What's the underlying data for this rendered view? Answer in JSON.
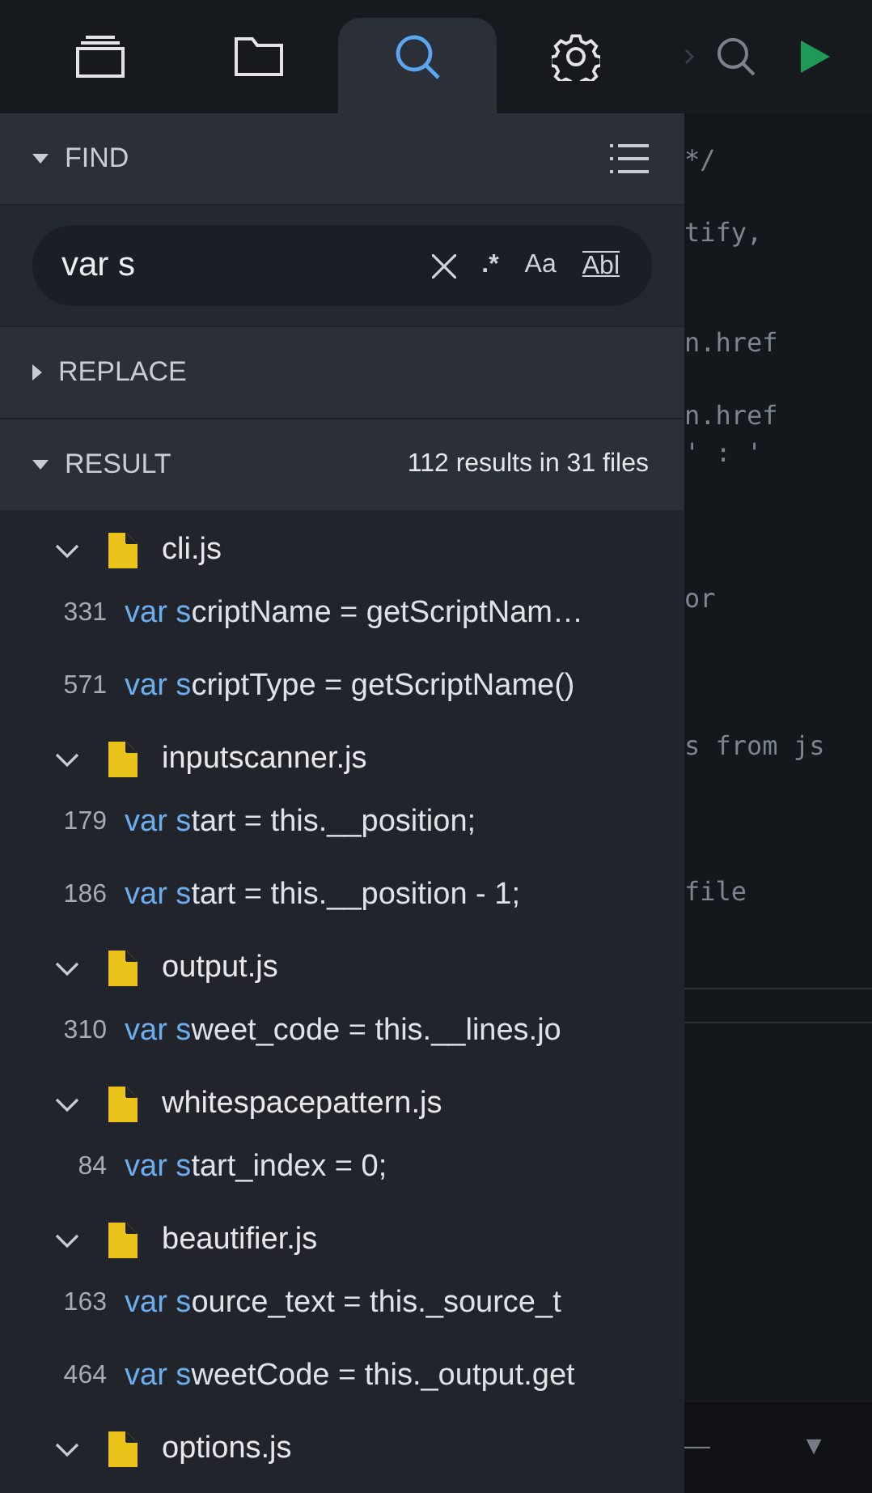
{
  "tabs": [
    {
      "kind": "windows",
      "selected": false
    },
    {
      "kind": "folder",
      "selected": false
    },
    {
      "kind": "search",
      "selected": true
    },
    {
      "kind": "settings",
      "selected": false
    }
  ],
  "find": {
    "title": "FIND",
    "expanded": true,
    "query": "var s",
    "regex_label": ".*",
    "case_label": "Aa",
    "word_label": "Abl"
  },
  "replace": {
    "title": "REPLACE",
    "expanded": false
  },
  "result": {
    "title": "RESULT",
    "expanded": true,
    "summary": "112 results in 31 files"
  },
  "files": [
    {
      "name": "cli.js",
      "expanded": true,
      "matches": [
        {
          "line": "331",
          "match": "var s",
          "rest": "criptName = getScriptNam…"
        },
        {
          "line": "571",
          "match": "var s",
          "rest": "criptType = getScriptName()"
        }
      ]
    },
    {
      "name": "inputscanner.js",
      "expanded": true,
      "matches": [
        {
          "line": "179",
          "match": "var s",
          "rest": "tart = this.__position;"
        },
        {
          "line": "186",
          "match": "var s",
          "rest": "tart = this.__position - 1;"
        }
      ]
    },
    {
      "name": "output.js",
      "expanded": true,
      "matches": [
        {
          "line": "310",
          "match": "var s",
          "rest": "weet_code = this.__lines.jo"
        }
      ]
    },
    {
      "name": "whitespacepattern.js",
      "expanded": true,
      "matches": [
        {
          "line": "84",
          "match": "var s",
          "rest": "tart_index = 0;"
        }
      ]
    },
    {
      "name": "beautifier.js",
      "expanded": true,
      "matches": [
        {
          "line": "163",
          "match": "var s",
          "rest": "ource_text = this._source_t"
        },
        {
          "line": "464",
          "match": "var s",
          "rest": "weetCode = this._output.get"
        }
      ]
    },
    {
      "name": "options.js",
      "expanded": true
    }
  ],
  "editor": {
    "lines": [
      "*/",
      "tify,",
      "n.href",
      "n.href",
      "' : '",
      "or",
      "s from js",
      "file"
    ],
    "bottom_dash": "—",
    "bottom_caret": "▼"
  }
}
